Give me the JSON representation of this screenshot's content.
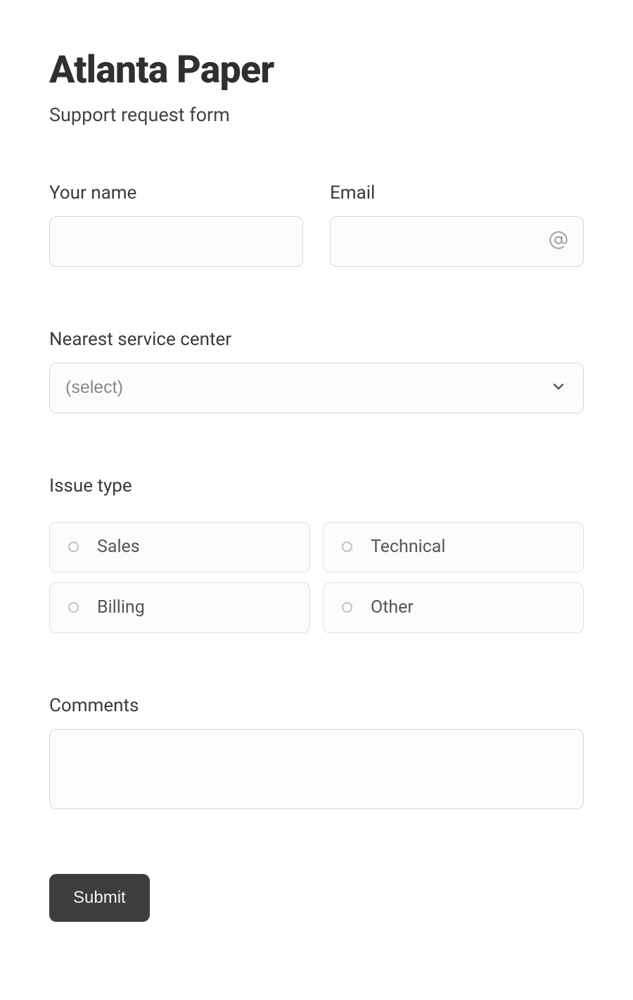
{
  "header": {
    "title": "Atlanta Paper",
    "subtitle": "Support request form"
  },
  "fields": {
    "name": {
      "label": "Your name",
      "value": ""
    },
    "email": {
      "label": "Email",
      "value": ""
    },
    "service_center": {
      "label": "Nearest service center",
      "placeholder": "(select)"
    },
    "issue_type": {
      "label": "Issue type",
      "options": [
        "Sales",
        "Technical",
        "Billing",
        "Other"
      ]
    },
    "comments": {
      "label": "Comments",
      "value": ""
    }
  },
  "actions": {
    "submit": "Submit"
  }
}
